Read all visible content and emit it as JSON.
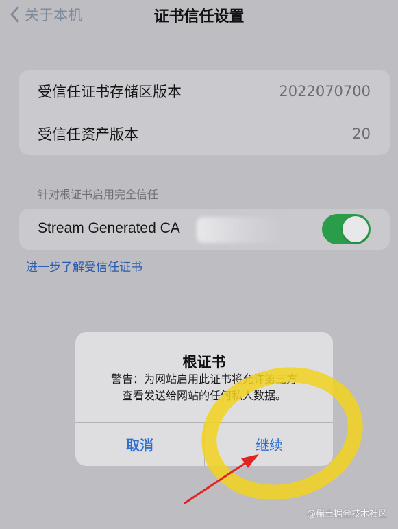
{
  "nav": {
    "back_label": "关于本机",
    "title": "证书信任设置"
  },
  "versions": {
    "rows": [
      {
        "label": "受信任证书存储区版本",
        "value": "2022070700"
      },
      {
        "label": "受信任资产版本",
        "value": "20"
      }
    ]
  },
  "trust_section": {
    "header": "针对根证书启用完全信任",
    "certificate_name": "Stream Generated CA",
    "toggle_on": true,
    "toggle_color": "#2a9d4a"
  },
  "learn_more_link": "进一步了解受信任证书",
  "alert": {
    "title": "根证书",
    "message_line1": "警告：为网站启用此证书将允许第三方",
    "message_line2": "查看发送给网站的任何私人数据。",
    "cancel_label": "取消",
    "continue_label": "继续",
    "button_color": "#2e6fd0"
  },
  "annotation": {
    "highlight_color": "#f2d21e",
    "arrow_color": "#e32222"
  },
  "watermark": "@稀土掘金技术社区"
}
